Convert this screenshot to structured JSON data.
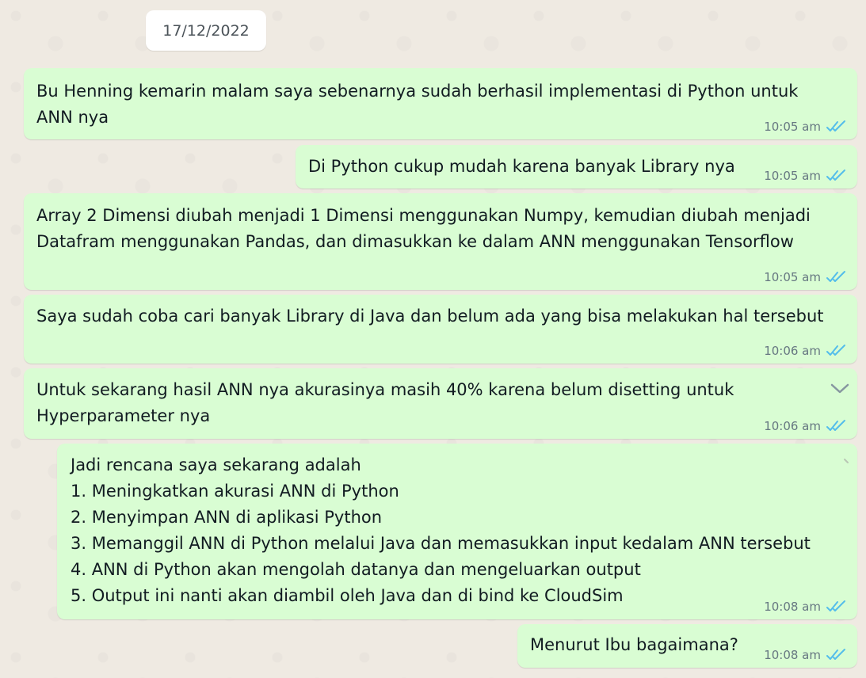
{
  "chat": {
    "date_chip": "17/12/2022",
    "messages": [
      {
        "text": "Bu Henning kemarin malam saya sebenarnya sudah berhasil implementasi di Python untuk\nANN nya",
        "time": "10:05 am"
      },
      {
        "text": "Di Python cukup mudah karena banyak Library nya",
        "time": "10:05 am"
      },
      {
        "text": "Array 2 Dimensi diubah menjadi 1 Dimensi menggunakan Numpy, kemudian diubah menjadi\nDatafram menggunakan Pandas, dan dimasukkan ke dalam ANN menggunakan Tensorflow",
        "time": "10:05 am"
      },
      {
        "text": "Saya sudah coba cari banyak Library di Java dan belum ada yang bisa melakukan hal tersebut",
        "time": "10:06 am"
      },
      {
        "text": "Untuk sekarang hasil ANN nya akurasinya masih 40% karena belum disetting untuk\nHyperparameter nya",
        "time": "10:06 am"
      },
      {
        "text": "Jadi rencana saya sekarang adalah\n1. Meningkatkan akurasi ANN di Python\n2. Menyimpan ANN di aplikasi Python\n3. Memanggil ANN di Python melalui Java dan memasukkan input kedalam ANN tersebut\n4. ANN di Python akan mengolah datanya dan mengeluarkan output\n5. Output ini nanti akan diambil oleh Java dan di bind ke CloudSim",
        "time": "10:08 am"
      },
      {
        "text": "Menurut Ibu bagaimana?",
        "time": "10:08 am"
      }
    ]
  },
  "icons": {
    "read_receipt": "double-check-icon",
    "message_menu": "chevron-down-icon"
  },
  "colors": {
    "background": "#efeae2",
    "outgoing_bubble": "#d9fdd3",
    "text": "#111b21",
    "meta_text": "#667781",
    "read_tick": "#53bdeb",
    "date_chip": "#ffffff"
  }
}
